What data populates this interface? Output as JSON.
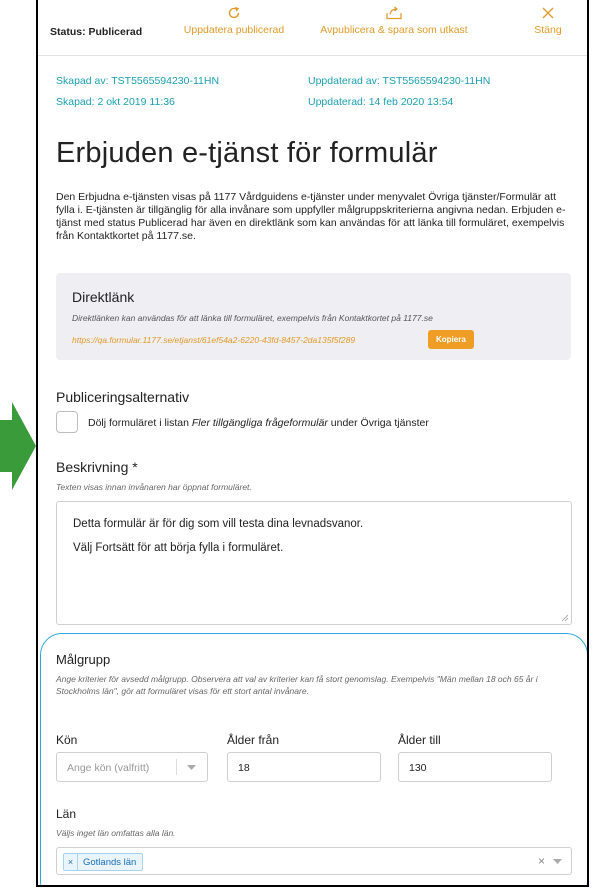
{
  "topbar": {
    "status": "Status: Publicerad",
    "update_label": "Uppdatera publicerad",
    "unpublish_label": "Avpublicera & spara som utkast",
    "close_label": "Stäng"
  },
  "meta": {
    "created_by": "Skapad av: TST5565594230-11HN",
    "created_at": "Skapad: 2 okt 2019 11:36",
    "updated_by": "Uppdaterad av: TST5565594230-11HN",
    "updated_at": "Uppdaterad: 14 feb 2020 13:54"
  },
  "page_title": "Erbjuden e-tjänst för formulär",
  "description": "Den Erbjudna e-tjänsten visas på 1177 Vårdguidens e-tjänster under menyvalet Övriga tjänster/Formulär att fylla i. E-tjänsten är tillgänglig för alla invånare som uppfyller målgruppskriterierna angivna nedan. Erbjuden e-tjänst med status Publicerad har även en direktlänk som kan användas för att länka till formuläret, exempelvis från Kontaktkortet på 1177.se.",
  "direct_link": {
    "title": "Direktlänk",
    "subtitle": "Direktlänken kan användas för att länka till formuläret, exempelvis från Kontaktkortet på 1177.se",
    "url": "https://qa.formular.1177.se/etjanst/61ef54a2-6220-43fd-8457-2da135f5f289",
    "copy_label": "Kopiera"
  },
  "publishing": {
    "title": "Publiceringsalternativ",
    "checkbox_prefix": "Dölj formuläret i listan ",
    "checkbox_italic": "Fler tillgängliga frågeformulär",
    "checkbox_suffix": " under Övriga tjänster",
    "checked": false
  },
  "beskrivning": {
    "title": "Beskrivning *",
    "hint": "Texten visas innan invånaren har öppnat formuläret.",
    "line1": "Detta formulär är för dig som vill testa dina levnadsvanor.",
    "line2": "Välj Fortsätt för att börja fylla i formuläret."
  },
  "malgrupp": {
    "title": "Målgrupp",
    "hint": "Ange kriterier för avsedd målgrupp. Observera att val av kriterier kan få stort genomslag. Exempelvis \"Män mellan 18 och 65 år i Stockholms län\", gör att formuläret visas för ett stort antal invånare.",
    "kon_label": "Kön",
    "kon_placeholder": "Ange kön (valfritt)",
    "age_from_label": "Ålder från",
    "age_from_value": "18",
    "age_to_label": "Ålder till",
    "age_to_value": "130",
    "lan_label": "Län",
    "lan_hint": "Väljs inget län omfattas alla län.",
    "lan_selected": "Gotlands län",
    "clear_glyph": "×"
  },
  "colors": {
    "accent": "#e09a2b",
    "meta_teal": "#1a9fb0",
    "highlight_ring": "#2aa7d9",
    "arrow_green": "#3a9b3a"
  }
}
